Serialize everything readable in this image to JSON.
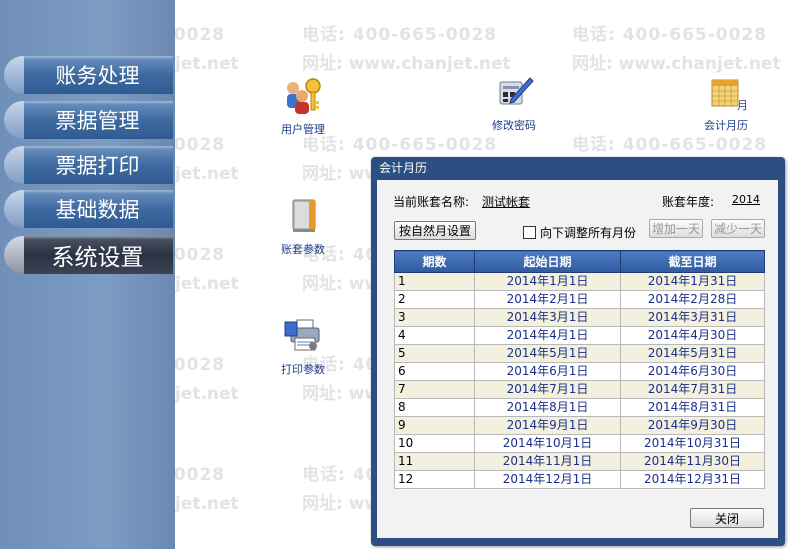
{
  "watermark": {
    "phone": "电话: 400-665-0028",
    "site": "网址: www.chanjet.net"
  },
  "sidebar": {
    "items": [
      {
        "label": "账务处理"
      },
      {
        "label": "票据管理"
      },
      {
        "label": "票据打印"
      },
      {
        "label": "基础数据"
      },
      {
        "label": "系统设置"
      }
    ],
    "active_index": 4
  },
  "tools": {
    "user_mgmt": "用户管理",
    "change_pwd": "修改密码",
    "accounting_calendar": "会计月历",
    "account_params": "账套参数",
    "print_params": "打印参数"
  },
  "dialog": {
    "title": "会计月历",
    "account_name_label": "当前账套名称:",
    "account_name": "测试帐套",
    "year_label": "账套年度:",
    "year": "2014",
    "btn_natural_month": "按自然月设置",
    "checkbox_adjust_label": "向下调整所有月份",
    "btn_add_day": "增加一天",
    "btn_sub_day": "减少一天",
    "columns": [
      "期数",
      "起始日期",
      "截至日期"
    ],
    "rows": [
      [
        "1",
        "2014年1月1日",
        "2014年1月31日"
      ],
      [
        "2",
        "2014年2月1日",
        "2014年2月28日"
      ],
      [
        "3",
        "2014年3月1日",
        "2014年3月31日"
      ],
      [
        "4",
        "2014年4月1日",
        "2014年4月30日"
      ],
      [
        "5",
        "2014年5月1日",
        "2014年5月31日"
      ],
      [
        "6",
        "2014年6月1日",
        "2014年6月30日"
      ],
      [
        "7",
        "2014年7月1日",
        "2014年7月31日"
      ],
      [
        "8",
        "2014年8月1日",
        "2014年8月31日"
      ],
      [
        "9",
        "2014年9月1日",
        "2014年9月30日"
      ],
      [
        "10",
        "2014年10月1日",
        "2014年10月31日"
      ],
      [
        "11",
        "2014年11月1日",
        "2014年11月30日"
      ],
      [
        "12",
        "2014年12月1日",
        "2014年12月31日"
      ]
    ],
    "btn_close": "关闭"
  }
}
